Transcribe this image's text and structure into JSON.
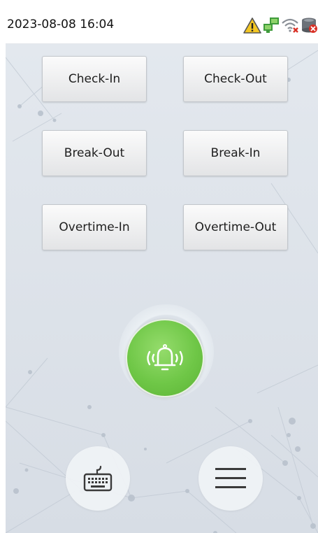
{
  "status_bar": {
    "datetime": "2023-08-08 16:04",
    "icons": [
      "warning-icon",
      "network-icon",
      "wifi-disconnected-icon",
      "cloud-disconnected-icon"
    ]
  },
  "punch_buttons": [
    {
      "label": "Check-In"
    },
    {
      "label": "Check-Out"
    },
    {
      "label": "Break-Out"
    },
    {
      "label": "Break-In"
    },
    {
      "label": "Overtime-In"
    },
    {
      "label": "Overtime-Out"
    }
  ],
  "bell_button": {
    "icon": "bell-ringing-icon",
    "color": "#6fc747"
  },
  "bottom_buttons": {
    "keyboard": {
      "icon": "keyboard-icon"
    },
    "menu": {
      "icon": "hamburger-menu-icon"
    }
  },
  "colors": {
    "background": "#dde3ea",
    "bell_green": "#6fc747",
    "warning_yellow": "#f3c623"
  }
}
